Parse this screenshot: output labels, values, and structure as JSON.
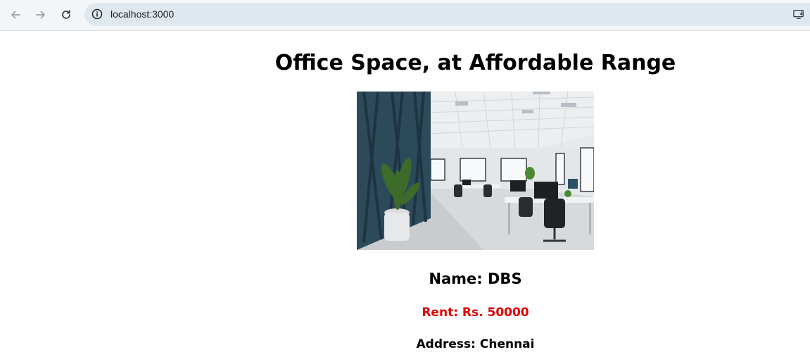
{
  "browser": {
    "url": "localhost:3000",
    "icons": {
      "back": "back-arrow-icon",
      "forward": "forward-arrow-icon",
      "reload": "reload-icon",
      "site_info": "info-icon",
      "cast": "cast-icon"
    }
  },
  "page": {
    "title": "Office Space, at Affordable Range",
    "image": "office-interior-photo",
    "name": "Name: DBS",
    "rent": "Rent: Rs. 50000",
    "address": "Address: Chennai"
  },
  "colors": {
    "rent_text": "#e00000",
    "toolbar_bg": "#f3f6f8",
    "omnibox_bg": "#dfe8ee"
  }
}
